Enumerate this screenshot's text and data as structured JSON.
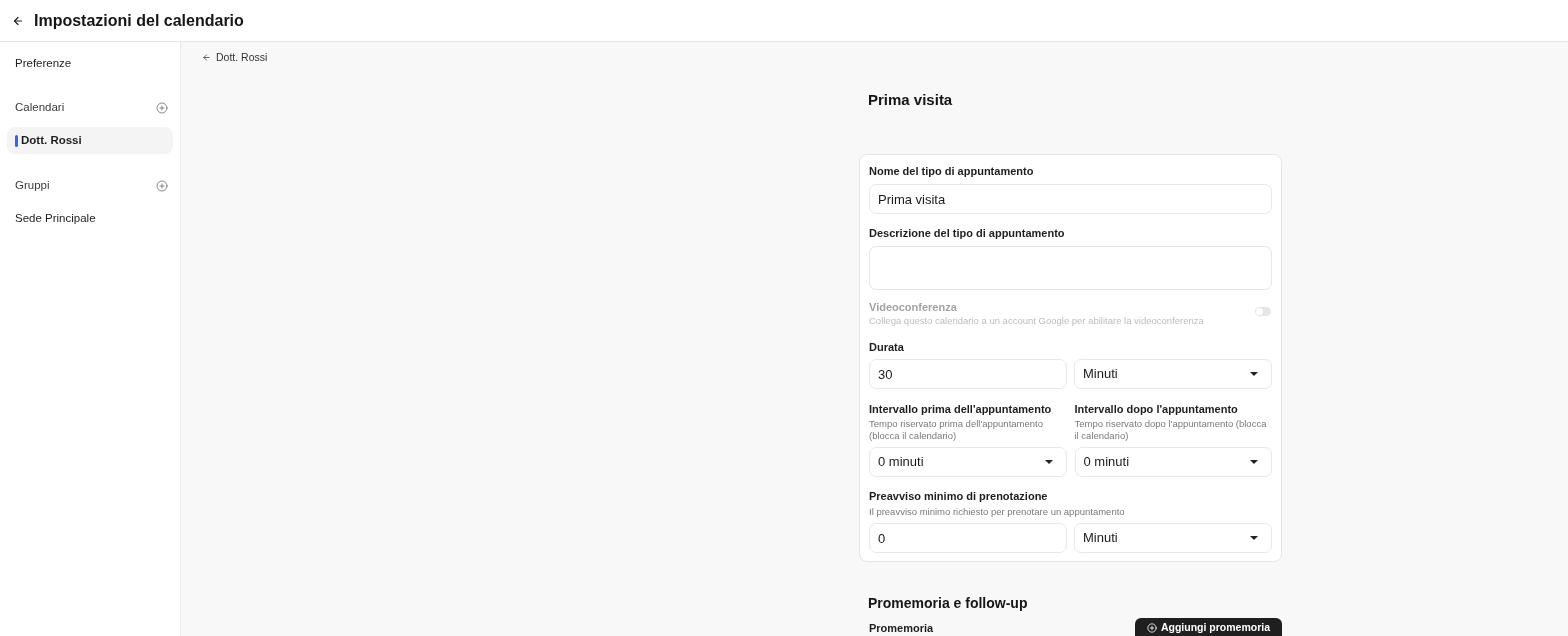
{
  "header": {
    "title": "Impostazioni del calendario"
  },
  "sidebar": {
    "top_items": [
      {
        "label": "Preferenze",
        "selected": false
      }
    ],
    "sections": [
      {
        "title": "Calendari",
        "items": [
          {
            "label": "Dott. Rossi",
            "selected": true
          }
        ]
      },
      {
        "title": "Gruppi",
        "items": [
          {
            "label": "Sede Principale",
            "selected": false
          }
        ]
      }
    ]
  },
  "main": {
    "back_link": "Dott. Rossi",
    "form": {
      "title": "Prima visita",
      "fields": [
        {
          "kind": "text",
          "label": "Nome del tipo di appuntamento",
          "value": "Prima visita"
        },
        {
          "kind": "textarea",
          "label": "Descrizione del tipo di appuntamento"
        },
        {
          "kind": "toggle",
          "label": "Videoconferenza",
          "description": "Collega questo calendario a un account Google per abilitare la videoconferenza",
          "disabled": true,
          "on": false
        },
        {
          "kind": "amount",
          "label": "Durata",
          "value": "30",
          "unit": "Minuti"
        },
        {
          "kind": "pair",
          "columns": [
            {
              "label": "Intervallo prima dell'appuntamento",
              "description": "Tempo riservato prima dell'appuntamento (blocca il calendario)",
              "value": "0 minuti"
            },
            {
              "label": "Intervallo dopo l'appuntamento",
              "description": "Tempo riservato dopo l'appuntamento (blocca il calendario)",
              "value": "0 minuti"
            }
          ]
        },
        {
          "kind": "amount",
          "label": "Preavviso minimo di prenotazione",
          "description": "Il preavviso minimo richiesto per prenotare un appuntamento",
          "value": "0",
          "unit": "Minuti"
        }
      ]
    },
    "reminders": {
      "title": "Promemoria e follow-up",
      "label": "Promemoria",
      "button": "Aggiungi promemoria"
    }
  }
}
